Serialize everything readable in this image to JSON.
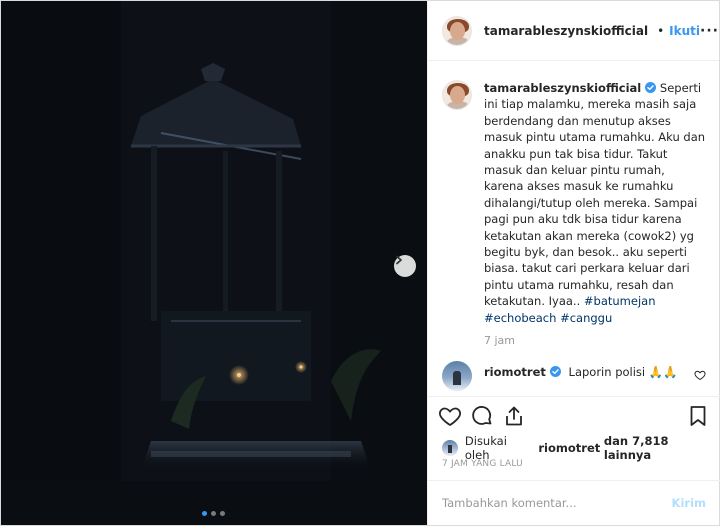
{
  "post": {
    "username": "tamarableszynskiofficial",
    "follow_label": "Ikuti",
    "separator": "•",
    "more_label": "···",
    "caption_user": "tamarableszynskiofficial",
    "caption_text": "Seperti ini tiap malamku, mereka masih saja berdendang dan menutup akses masuk pintu utama rumahku. Aku dan anakku pun tak bisa tidur. Takut masuk dan keluar pintu rumah, karena akses masuk ke rumahku dihalangi/tutup oleh mereka. Sampai pagi pun aku tdk bisa tidur karena ketakutan akan mereka (cowok2) yg begitu byk, dan besok.. aku seperti biasa. takut cari perkara keluar dari pintu utama rumahku, resah dan ketakutan. Iyaa..",
    "hashtags": [
      "#batumejan",
      "#echobeach",
      "#canggu"
    ],
    "caption_time": "7 jam",
    "comment": {
      "user": "riomotret",
      "text": "Laporin polisi 🙏🙏"
    },
    "likes": {
      "prefix": "Disukai oleh",
      "user": "riomotret",
      "suffix": "dan 7,818 lainnya"
    },
    "post_time": "7 JAM YANG LALU",
    "comment_input": {
      "placeholder": "Tambahkan komentar...",
      "value": ""
    },
    "post_button": "Kirim"
  },
  "media": {
    "carousel_count": 3,
    "active_index": 1
  },
  "colors": {
    "link": "#3897f0",
    "hashtag": "#003569",
    "muted": "#999999",
    "post_disabled": "#b2dffc",
    "verified": "#3897f0"
  },
  "icons": [
    "verified-icon",
    "heart-icon",
    "comment-icon",
    "share-icon",
    "bookmark-icon",
    "chevron-right-icon"
  ]
}
